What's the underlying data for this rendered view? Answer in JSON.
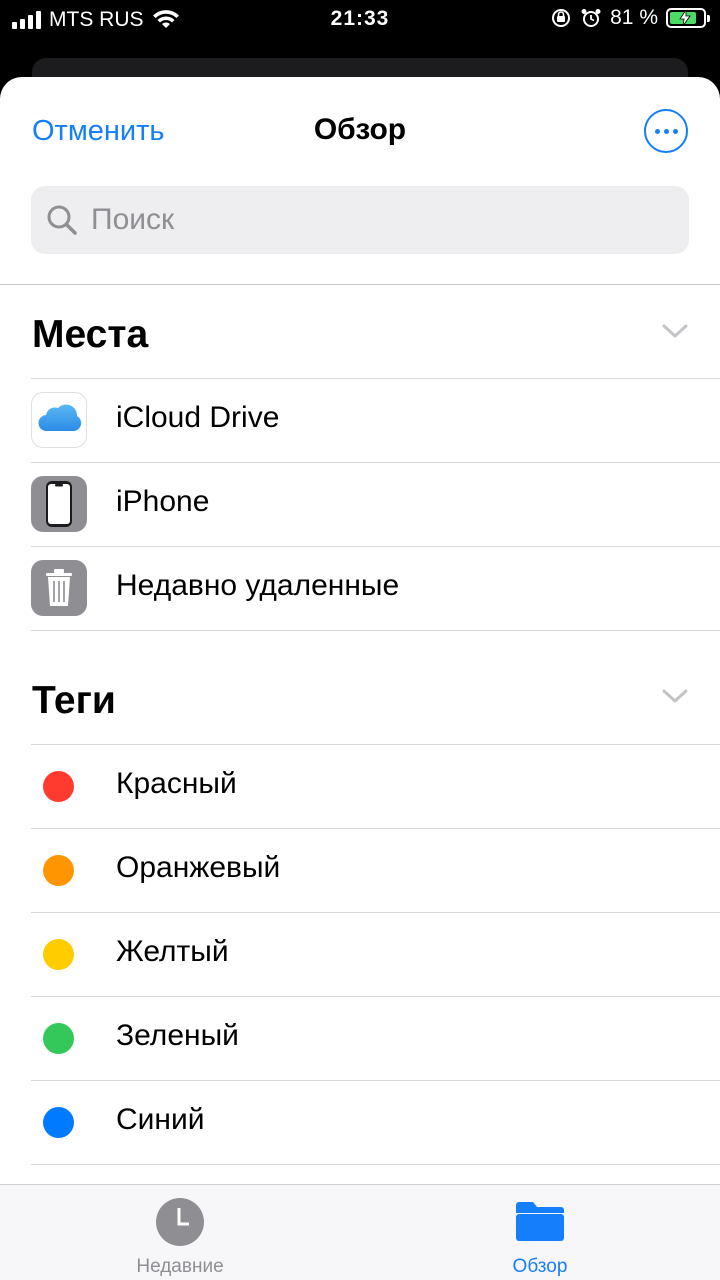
{
  "status_bar": {
    "carrier": "MTS RUS",
    "time": "21:33",
    "battery_percent": "81 %",
    "battery_level": 0.81
  },
  "nav": {
    "cancel_label": "Отменить",
    "title": "Обзор",
    "more_icon": "ellipsis-circle-icon"
  },
  "search": {
    "placeholder": "Поиск",
    "value": ""
  },
  "places": {
    "title": "Места",
    "items": [
      {
        "label": "iCloud Drive",
        "icon": "icloud-icon"
      },
      {
        "label": "iPhone",
        "icon": "iphone-icon"
      },
      {
        "label": "Недавно удаленные",
        "icon": "trash-icon"
      }
    ]
  },
  "tags": {
    "title": "Теги",
    "items": [
      {
        "label": "Красный",
        "color": "#ff3b30"
      },
      {
        "label": "Оранжевый",
        "color": "#ff9500"
      },
      {
        "label": "Желтый",
        "color": "#ffcc00"
      },
      {
        "label": "Зеленый",
        "color": "#34c759"
      },
      {
        "label": "Синий",
        "color": "#007aff"
      }
    ]
  },
  "tabbar": {
    "recent_label": "Недавние",
    "browse_label": "Обзор",
    "active_tab": "browse"
  },
  "colors": {
    "accent": "#147efb",
    "inactive": "#8e8e93"
  }
}
